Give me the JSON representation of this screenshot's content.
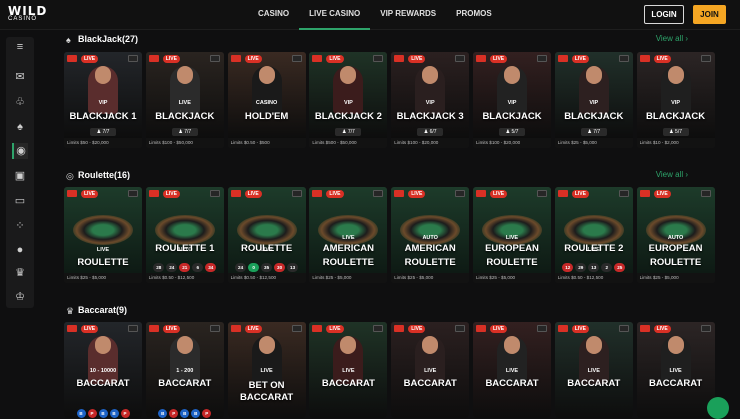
{
  "brand": {
    "name": "WILD",
    "sub": "CASINO"
  },
  "nav": [
    "CASINO",
    "LIVE CASINO",
    "VIP REWARDS",
    "PROMOS"
  ],
  "auth": {
    "login": "LOGIN",
    "join": "JOIN"
  },
  "sections": [
    {
      "title": "BlackJack",
      "count": "(27)",
      "view_all": "View all"
    },
    {
      "title": "Roulette",
      "count": "(16)",
      "view_all": "View all"
    },
    {
      "title": "Baccarat",
      "count": "(9)"
    }
  ],
  "live_badge": "LIVE",
  "blackjack": [
    {
      "top": "VIP",
      "name": "BLACKJACK 1",
      "seats": "7/7",
      "limits": "Limits $50 - $20,000"
    },
    {
      "top": "LIVE",
      "name": "BLACKJACK",
      "seats": "7/7",
      "limits": "Limits $100 - $50,000"
    },
    {
      "top": "CASINO",
      "name": "HOLD'EM",
      "seats": "",
      "limits": "Limits $0.50 - $500"
    },
    {
      "top": "VIP",
      "name": "BLACKJACK 2",
      "seats": "7/7",
      "limits": "Limits $500 - $50,000"
    },
    {
      "top": "VIP",
      "name": "BLACKJACK 3",
      "seats": "6/7",
      "limits": "Limits $100 - $20,000"
    },
    {
      "top": "VIP",
      "name": "BLACKJACK",
      "seats": "5/7",
      "limits": "Limits $100 - $20,000"
    },
    {
      "top": "VIP",
      "name": "BLACKJACK",
      "seats": "7/7",
      "limits": "Limits $25 - $5,000"
    },
    {
      "top": "VIP",
      "name": "BLACKJACK",
      "seats": "5/7",
      "limits": "Limits $10 - $2,000"
    }
  ],
  "roulette": [
    {
      "top": "LIVE",
      "name": "ROULETTE",
      "name2": "",
      "limits": "Limits $25 - $5,000",
      "nums": []
    },
    {
      "top": "AUTO",
      "name": "ROULETTE 1",
      "name2": "",
      "limits": "Limits $0.50 - $12,500",
      "nums": [
        "28",
        "24",
        "21",
        "6",
        "34"
      ]
    },
    {
      "top": "LIVE",
      "name": "ROULETTE",
      "name2": "",
      "limits": "Limits $0.50 - $12,500",
      "nums": [
        "24",
        "0",
        "35",
        "30",
        "13"
      ]
    },
    {
      "top": "LIVE",
      "name": "AMERICAN",
      "name2": "ROULETTE",
      "limits": "Limits $25 - $5,000",
      "nums": []
    },
    {
      "top": "AUTO",
      "name": "AMERICAN",
      "name2": "ROULETTE",
      "limits": "Limits $25 - $5,000",
      "nums": []
    },
    {
      "top": "LIVE",
      "name": "EUROPEAN",
      "name2": "ROULETTE",
      "limits": "Limits $25 - $5,000",
      "nums": []
    },
    {
      "top": "LIVE",
      "name": "ROULETTE 2",
      "name2": "",
      "limits": "Limits $0.50 - $12,500",
      "nums": [
        "12",
        "29",
        "13",
        "2",
        "25"
      ]
    },
    {
      "top": "AUTO",
      "name": "EUROPEAN",
      "name2": "ROULETTE",
      "limits": "Limits $25 - $5,000",
      "nums": []
    }
  ],
  "baccarat": [
    {
      "top": "10 - 10000",
      "name": "BACCARAT",
      "bp": [
        "B",
        "P",
        "B",
        "B",
        "P"
      ]
    },
    {
      "top": "1 - 200",
      "name": "BACCARAT",
      "bp": [
        "B",
        "P",
        "B",
        "B",
        "P"
      ]
    },
    {
      "top": "LIVE",
      "name": "BET ON",
      "name2": "BACCARAT",
      "bp": []
    },
    {
      "top": "LIVE",
      "name": "BACCARAT",
      "bp": []
    },
    {
      "top": "LIVE",
      "name": "BACCARAT",
      "bp": []
    },
    {
      "top": "LIVE",
      "name": "BACCARAT",
      "bp": []
    },
    {
      "top": "LIVE",
      "name": "BACCARAT",
      "bp": []
    },
    {
      "top": "LIVE",
      "name": "BACCARAT",
      "bp": []
    }
  ],
  "colors": {
    "accent": "#2ea36a",
    "join": "#f5a623",
    "live": "#d93025"
  },
  "icons": [
    "menu-icon",
    "chat-bubbles-icon",
    "cherries-icon",
    "spade-icon",
    "dealer-icon",
    "cards-icon",
    "laptop-icon",
    "dice-icon",
    "basketball-icon",
    "trophy-icon",
    "crown-icon"
  ]
}
